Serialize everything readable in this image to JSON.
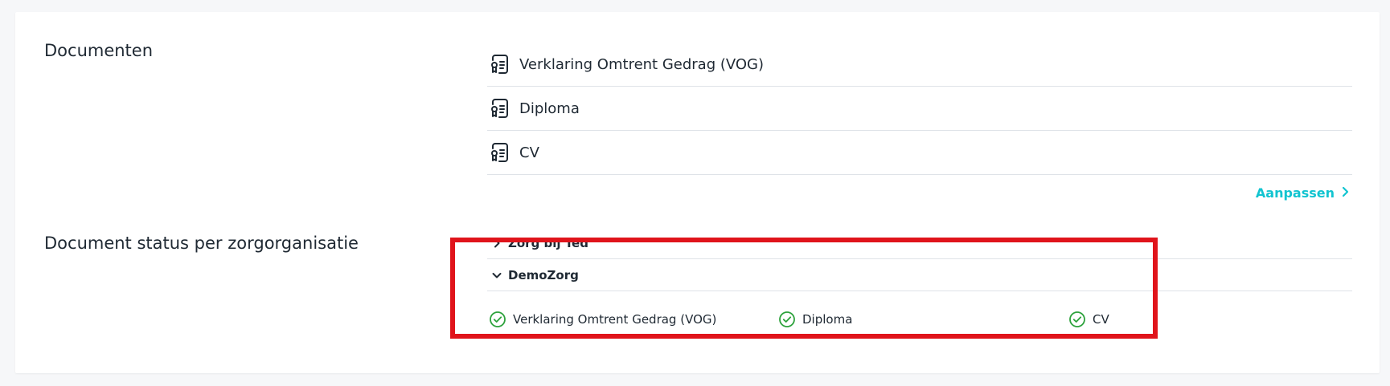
{
  "documents_section": {
    "title": "Documenten",
    "items": [
      {
        "label": "Verklaring Omtrent Gedrag (VOG)",
        "icon": "document-icon"
      },
      {
        "label": "Diploma",
        "icon": "document-icon"
      },
      {
        "label": "CV",
        "icon": "document-icon"
      }
    ],
    "edit_label": "Aanpassen"
  },
  "status_section": {
    "title": "Document status per zorgorganisatie",
    "organizations": [
      {
        "name": "Zorg bij Ted",
        "expanded": false
      },
      {
        "name": "DemoZorg",
        "expanded": true,
        "documents": [
          {
            "label": "Verklaring Omtrent Gedrag (VOG)",
            "status": "check-circle-icon"
          },
          {
            "label": "Diploma",
            "status": "check-circle-icon"
          },
          {
            "label": "CV",
            "status": "check-circle-icon"
          }
        ]
      }
    ]
  },
  "colors": {
    "accent": "#12c4d0",
    "success": "#2da23c",
    "highlight": "#e0141b"
  }
}
